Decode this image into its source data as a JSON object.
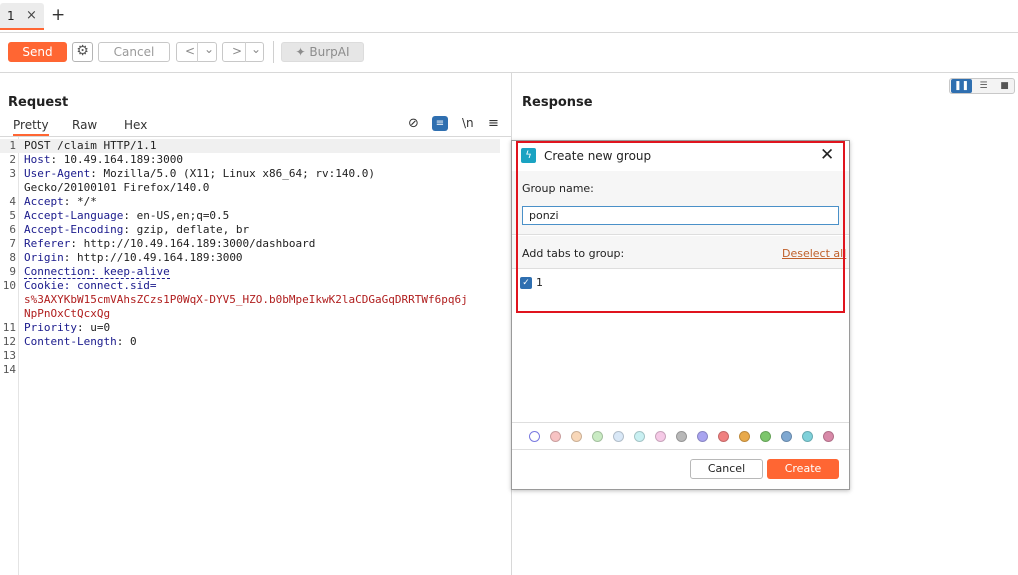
{
  "tabs": [
    {
      "label": "1",
      "close": "×"
    }
  ],
  "add_tab": "+",
  "toolbar": {
    "send_label": "Send",
    "cancel_label": "Cancel",
    "back": "<",
    "back_menu": "⌄",
    "forward": ">",
    "forward_menu": "⌄",
    "burpai_label": "BurpAI"
  },
  "request": {
    "title": "Request",
    "tabs": [
      "Pretty",
      "Raw",
      "Hex"
    ],
    "newline_icon": "\\n",
    "lines": [
      {
        "n": "1",
        "k": "",
        "v": "POST /claim HTTP/1.1"
      },
      {
        "n": "2",
        "k": "Host",
        "v": ": 10.49.164.189:3000"
      },
      {
        "n": "3",
        "k": "User-Agent",
        "v": ": Mozilla/5.0 (X11; Linux x86_64; rv:140.0)"
      },
      {
        "n": "",
        "k": "",
        "v": "Gecko/20100101 Firefox/140.0"
      },
      {
        "n": "4",
        "k": "Accept",
        "v": ": */*"
      },
      {
        "n": "5",
        "k": "Accept-Language",
        "v": ": en-US,en;q=0.5"
      },
      {
        "n": "6",
        "k": "Accept-Encoding",
        "v": ": gzip, deflate, br"
      },
      {
        "n": "7",
        "k": "Referer",
        "v": ": http://10.49.164.189:3000/dashboard"
      },
      {
        "n": "8",
        "k": "Origin",
        "v": ": http://10.49.164.189:3000"
      },
      {
        "n": "9",
        "k": "Connection",
        "v": ": keep-alive"
      },
      {
        "n": "10",
        "k": "Cookie",
        "v": ": connect.sid="
      },
      {
        "n": "",
        "k": "",
        "v": "s%3AXYKbW15cmVAhsZCzs1P0WqX-DYV5_HZO.b0bMpeIkwK2laCDGaGqDRRTWf6pq6j"
      },
      {
        "n": "",
        "k": "",
        "v": "NpPnOxCtQcxQg"
      },
      {
        "n": "11",
        "k": "Priority",
        "v": ": u=0"
      },
      {
        "n": "12",
        "k": "Content-Length",
        "v": ": 0"
      },
      {
        "n": "13",
        "k": "",
        "v": ""
      },
      {
        "n": "14",
        "k": "",
        "v": ""
      }
    ]
  },
  "response": {
    "title": "Response"
  },
  "dialog": {
    "title": "Create new group",
    "group_name_label": "Group name:",
    "group_name_value": "ponzi",
    "add_tabs_label": "Add tabs to group:",
    "deselect_all": "Deselect all",
    "tab_items": [
      {
        "label": "1",
        "checked": true
      }
    ],
    "colors": [
      "#ffffff",
      "#f7c3c3",
      "#f8d7b8",
      "#c9ebc3",
      "#d9e8f7",
      "#c9f0f2",
      "#f5c9e6",
      "#b8b8b8",
      "#a9a4f0",
      "#f08080",
      "#e8a94a",
      "#7cc66c",
      "#7fa8d1",
      "#7fd1da",
      "#d889a8"
    ],
    "cancel_label": "Cancel",
    "create_label": "Create"
  }
}
